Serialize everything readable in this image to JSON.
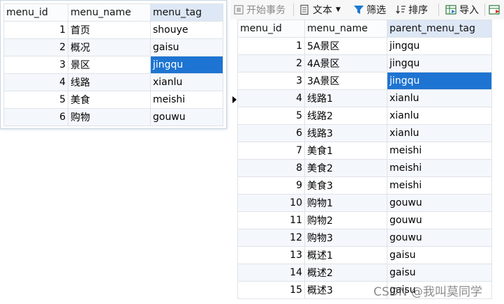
{
  "left_table": {
    "columns": [
      "menu_id",
      "menu_name",
      "menu_tag"
    ],
    "rows": [
      {
        "menu_id": "1",
        "menu_name": "首页",
        "menu_tag": "shouye"
      },
      {
        "menu_id": "2",
        "menu_name": "概况",
        "menu_tag": "gaisu"
      },
      {
        "menu_id": "3",
        "menu_name": "景区",
        "menu_tag": "jingqu"
      },
      {
        "menu_id": "4",
        "menu_name": "线路",
        "menu_tag": "xianlu"
      },
      {
        "menu_id": "5",
        "menu_name": "美食",
        "menu_tag": "meishi"
      },
      {
        "menu_id": "6",
        "menu_name": "购物",
        "menu_tag": "gouwu"
      }
    ]
  },
  "toolbar": {
    "begin_transaction": "开始事务",
    "text": "文本",
    "filter": "筛选",
    "sort": "排序",
    "import": "导入"
  },
  "right_table": {
    "columns": [
      "menu_id",
      "menu_name",
      "parent_menu_tag"
    ],
    "rows": [
      {
        "menu_id": "1",
        "menu_name": "5A景区",
        "parent_menu_tag": "jingqu"
      },
      {
        "menu_id": "2",
        "menu_name": "4A景区",
        "parent_menu_tag": "jingqu"
      },
      {
        "menu_id": "3",
        "menu_name": "3A景区",
        "parent_menu_tag": "jingqu"
      },
      {
        "menu_id": "4",
        "menu_name": "线路1",
        "parent_menu_tag": "xianlu"
      },
      {
        "menu_id": "5",
        "menu_name": "线路2",
        "parent_menu_tag": "xianlu"
      },
      {
        "menu_id": "6",
        "menu_name": "线路3",
        "parent_menu_tag": "xianlu"
      },
      {
        "menu_id": "7",
        "menu_name": "美食1",
        "parent_menu_tag": "meishi"
      },
      {
        "menu_id": "8",
        "menu_name": "美食2",
        "parent_menu_tag": "meishi"
      },
      {
        "menu_id": "9",
        "menu_name": "美食3",
        "parent_menu_tag": "meishi"
      },
      {
        "menu_id": "10",
        "menu_name": "购物1",
        "parent_menu_tag": "gouwu"
      },
      {
        "menu_id": "11",
        "menu_name": "购物2",
        "parent_menu_tag": "gouwu"
      },
      {
        "menu_id": "12",
        "menu_name": "购物3",
        "parent_menu_tag": "gouwu"
      },
      {
        "menu_id": "13",
        "menu_name": "概述1",
        "parent_menu_tag": "gaisu"
      },
      {
        "menu_id": "14",
        "menu_name": "概述2",
        "parent_menu_tag": "gaisu"
      },
      {
        "menu_id": "15",
        "menu_name": "概述3",
        "parent_menu_tag": "gaisu"
      }
    ]
  },
  "watermark": "CSDN @我叫莫同学",
  "colors": {
    "selection": "#1e74d2",
    "alt_row": "#f4f7fb",
    "grid": "#dfe3e8"
  }
}
